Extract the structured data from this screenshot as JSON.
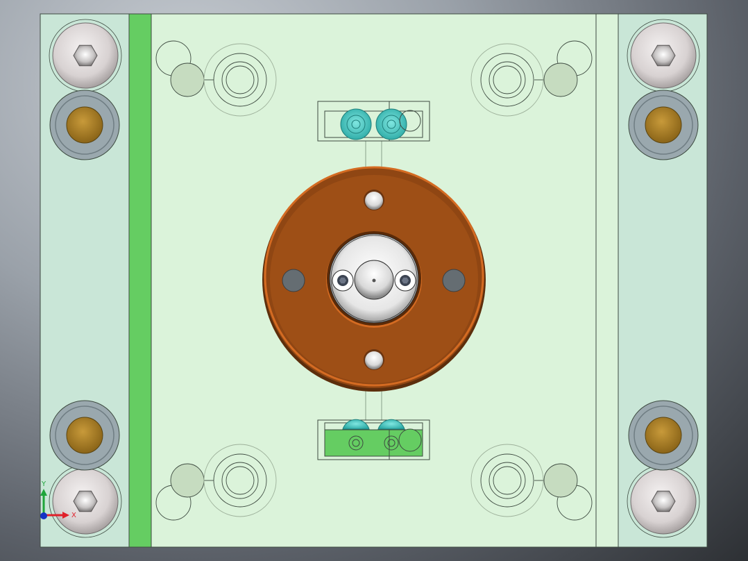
{
  "view": {
    "background_top": "#c9ced4",
    "background_bottom": "#2d3034"
  },
  "colors": {
    "plate_fill": "#dbf3da",
    "side_plate_fill": "#c9e6d7",
    "green_strip": "#65cd62",
    "outline": "#3d4a40",
    "flange_outer": "#8f4613",
    "flange_face": "#9e4f16",
    "flange_rim": "#d46b22",
    "bushing_gold": "#b08326",
    "washer_grey": "#9aa8ae",
    "screw_head": "#e3dede",
    "cyan_nozzle": "#3dc9c3",
    "axis_x": "#e0202a",
    "axis_y": "#1ea53a",
    "axis_origin": "#1533c4"
  },
  "triad": {
    "x_label": "X",
    "y_label": "Y"
  },
  "icons": {
    "screws": "socket-head-cap-screw-icon",
    "bushings": "guide-bushing-icon",
    "flange": "locating-ring-icon"
  }
}
